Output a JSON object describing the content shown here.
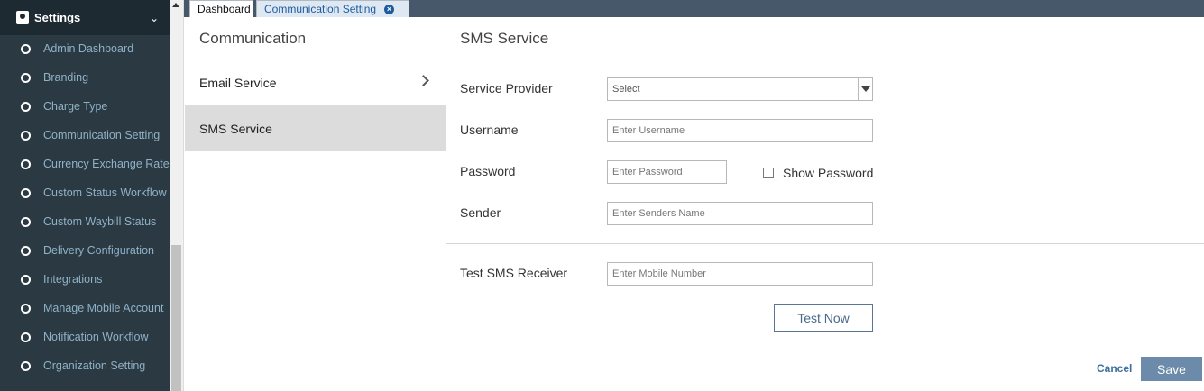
{
  "sidebar": {
    "header": {
      "title": "Settings",
      "icon": "settings-user-icon"
    },
    "items": [
      {
        "label": "Admin Dashboard"
      },
      {
        "label": "Branding"
      },
      {
        "label": "Charge Type"
      },
      {
        "label": "Communication Setting"
      },
      {
        "label": "Currency Exchange Rate"
      },
      {
        "label": "Custom Status Workflow"
      },
      {
        "label": "Custom Waybill Status"
      },
      {
        "label": "Delivery Configuration"
      },
      {
        "label": "Integrations"
      },
      {
        "label": "Manage Mobile Account"
      },
      {
        "label": "Notification Workflow"
      },
      {
        "label": "Organization Setting"
      }
    ]
  },
  "tabs": [
    {
      "label": "Dashboard"
    },
    {
      "label": "Communication Setting"
    }
  ],
  "communication": {
    "title": "Communication",
    "items": [
      {
        "label": "Email Service"
      },
      {
        "label": "SMS Service"
      }
    ]
  },
  "sms": {
    "title": "SMS Service",
    "provider_label": "Service Provider",
    "provider_value": "Select",
    "username_label": "Username",
    "username_placeholder": "Enter Username",
    "password_label": "Password",
    "password_placeholder": "Enter Password",
    "show_password_label": "Show Password",
    "sender_label": "Sender",
    "sender_placeholder": "Enter Senders Name",
    "test_label": "Test SMS Receiver",
    "test_placeholder": "Enter Mobile Number",
    "test_button": "Test Now",
    "cancel": "Cancel",
    "save": "Save"
  },
  "colors": {
    "sidebar_bg": "#2b3a42",
    "accent": "#6c8aaa",
    "link": "#3d6f9e"
  }
}
